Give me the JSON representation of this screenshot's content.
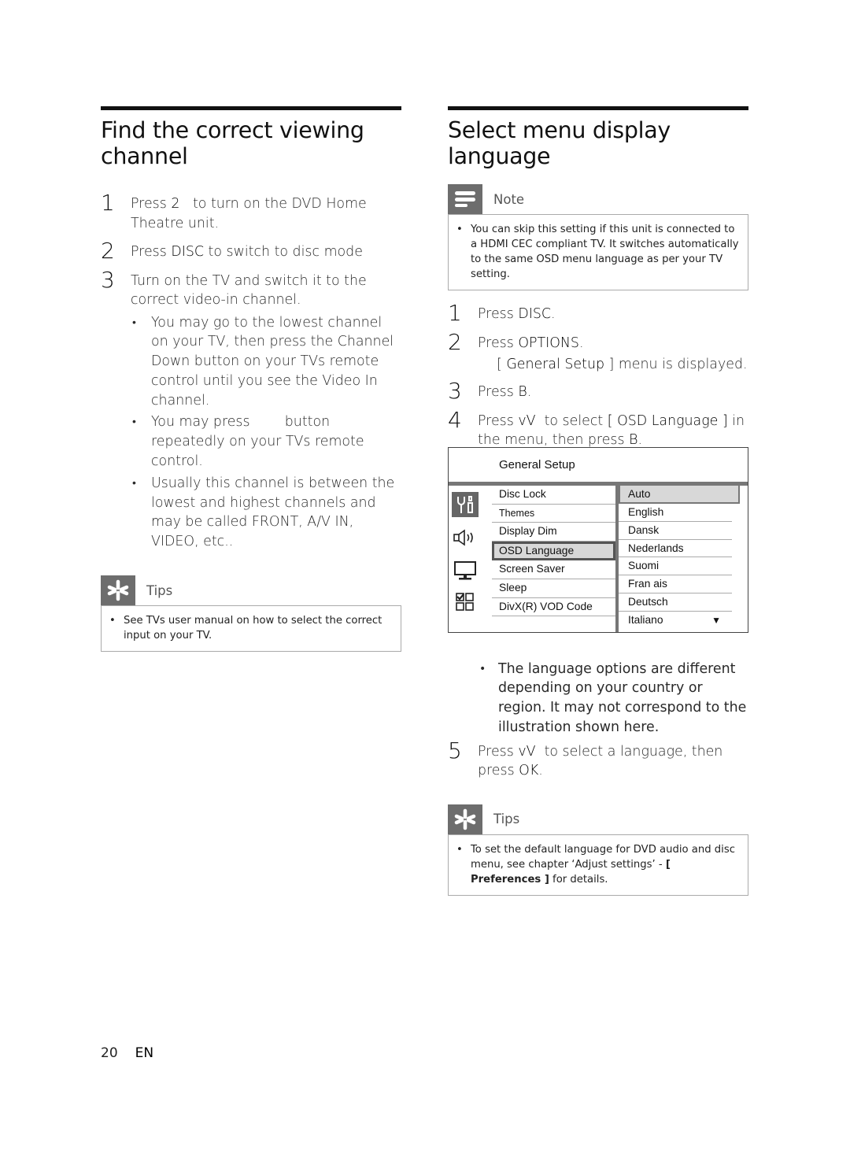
{
  "left": {
    "title": "Find the correct viewing channel",
    "steps": [
      {
        "num": "1",
        "pre": "Press ",
        "key": "2",
        "post": "   to turn on the DVD Home Theatre unit."
      },
      {
        "num": "2",
        "pre": "Press ",
        "key": "DISC",
        "post": " to switch to disc mode"
      },
      {
        "num": "3",
        "pre": "Turn on the TV and switch it to the correct video-in channel.",
        "key": "",
        "post": ""
      }
    ],
    "bullets": [
      "You may go to the lowest channel on your TV, then press the Channel Down button on your TVs remote control until you see the Video In channel.",
      "You may press        button repeatedly on your TVs remote control.",
      "Usually this channel is between the lowest and highest channels and may be called FRONT, A/V IN, VIDEO, etc.."
    ],
    "tips": {
      "label": "Tips",
      "icon": "asterisk-icon",
      "text": "See TVs user manual on how to select the correct input on your TV."
    }
  },
  "right": {
    "title": "Select menu display language",
    "note": {
      "label": "Note",
      "icon": "note-lines-icon",
      "text": "You can skip this setting if this unit is connected to a HDMI CEC compliant TV.  It switches automatically to the same OSD menu language as per your TV setting."
    },
    "steps": [
      {
        "num": "1",
        "pre": "Press ",
        "key": "DISC",
        "post": "."
      },
      {
        "num": "2",
        "pre": "Press ",
        "key": "OPTIONS",
        "post": "."
      },
      {
        "num": "3",
        "pre": "Press ",
        "key": "B",
        "post": "."
      },
      {
        "num": "4",
        "pre": "Press ",
        "key": "vV",
        "mid": "  to select ",
        "key2": "[ OSD Language ]",
        "post": " in the menu, then press ",
        "key3": "B",
        "post2": "."
      },
      {
        "num": "5",
        "pre": "Press ",
        "key": "vV",
        "post": "  to select a language, then press ",
        "key2": "OK",
        "post2": "."
      }
    ],
    "step2_sub": {
      "pre": "[ ",
      "key": "General Setup",
      "post": " ] menu is displayed."
    },
    "bullet": "The language options are different depending on your country or region. It may not correspond to the illustration shown here.",
    "tips": {
      "label": "Tips",
      "icon": "asterisk-icon",
      "text_pre": "To set the default language for DVD audio and disc menu, see chapter ‘Adjust settings’ - ",
      "text_key": "[ Preferences ]",
      "text_post": " for details."
    }
  },
  "osd": {
    "title": "General Setup",
    "icons": [
      "general-setup-tools-icon",
      "audio-speaker-icon",
      "video-monitor-icon",
      "preferences-checkbox-icon"
    ],
    "menu_items": [
      "Disc Lock",
      "Themes",
      "Display Dim",
      "OSD Language",
      "Screen Saver",
      "Sleep",
      "DivX(R) VOD Code"
    ],
    "selected_menu_item": "OSD Language",
    "options": [
      "Auto",
      "English",
      "Dansk",
      "Nederlands",
      "Suomi",
      "Fran ais",
      "Deutsch",
      "Italiano"
    ],
    "selected_option": "Auto",
    "scroll_indicator": "▼"
  },
  "footer": {
    "page": "20",
    "lang": "EN"
  }
}
